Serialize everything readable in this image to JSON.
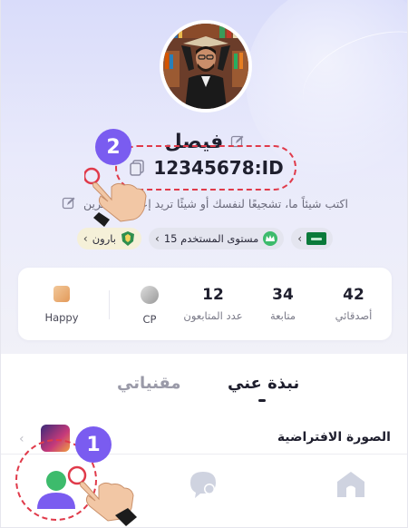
{
  "profile": {
    "name": "فيصل",
    "id_label": "12345678:ID",
    "bio": "اكتب شيئاً ما، تشجيعًا لنفسك أو شيئًا تريد إعلامه للآخرين"
  },
  "badges": {
    "level_label": "مستوى المستخدم 15",
    "baron_label": "بارون"
  },
  "stats": {
    "friends": {
      "value": "42",
      "label": "أصدقائي"
    },
    "following": {
      "value": "34",
      "label": "متابعة"
    },
    "followers": {
      "value": "12",
      "label": "عدد المتابعون"
    },
    "cp": {
      "label": "CP"
    },
    "happy": {
      "label": "Happy"
    }
  },
  "tabs": {
    "about": "نبذة عني",
    "items": "مقنياتي"
  },
  "section": {
    "default_avatar": "الصورة الافتراضية"
  },
  "annotations": {
    "step1": "1",
    "step2": "2"
  },
  "colors": {
    "accent": "#7a5cf0",
    "highlight": "#e03a4a",
    "nav_active": "#3dbb6c"
  }
}
